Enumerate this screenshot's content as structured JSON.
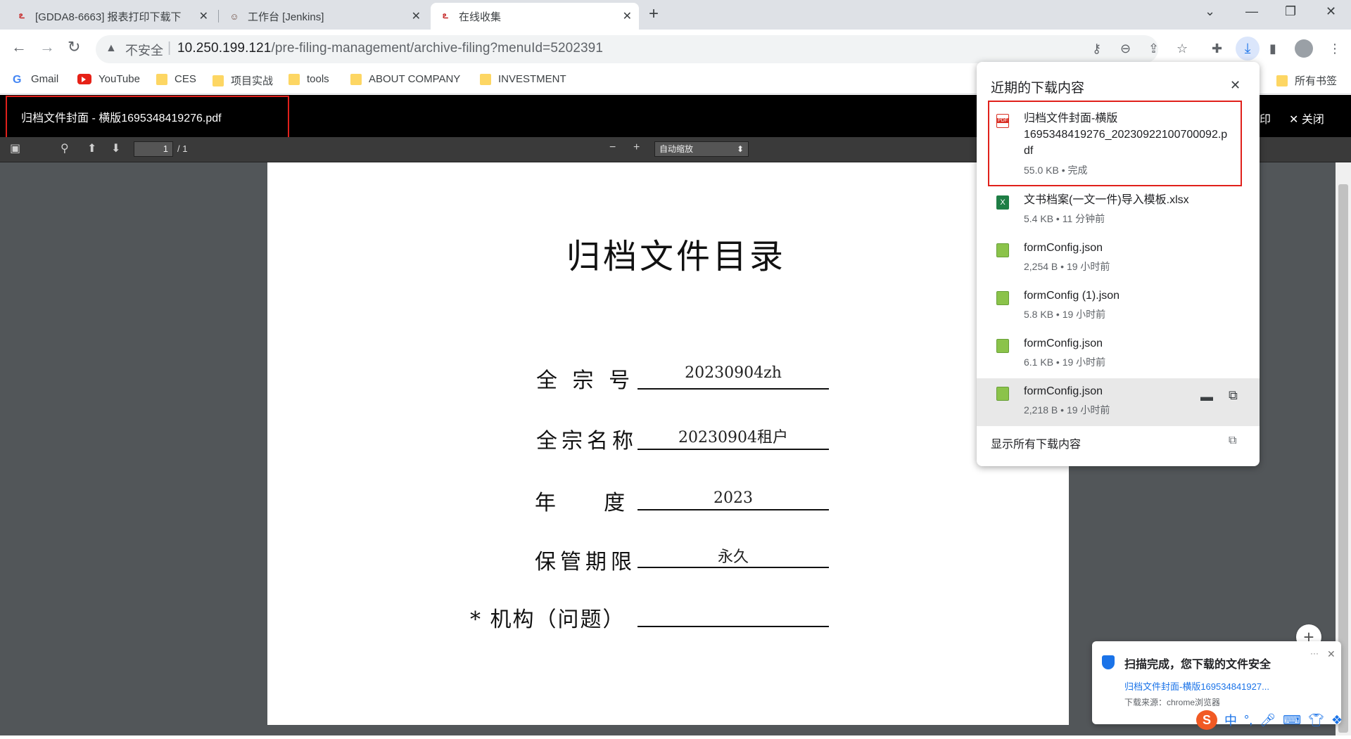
{
  "tabs": [
    {
      "title": "[GDDA8-6663] 报表打印下载下"
    },
    {
      "title": "工作台 [Jenkins]"
    },
    {
      "title": "在线收集"
    }
  ],
  "omnibox": {
    "security_label": "不安全",
    "url_host": "10.250.199.121",
    "url_path": "/pre-filing-management/archive-filing?menuId=5202391"
  },
  "bookmarks": [
    {
      "label": "Gmail",
      "icon": "google-icon"
    },
    {
      "label": "YouTube",
      "icon": "youtube-icon"
    },
    {
      "label": "CES",
      "icon": "folder-icon"
    },
    {
      "label": "项目实战",
      "icon": "folder-icon"
    },
    {
      "label": "tools",
      "icon": "folder-icon"
    },
    {
      "label": "ABOUT COMPANY",
      "icon": "folder-icon"
    },
    {
      "label": "INVESTMENT",
      "icon": "folder-icon"
    },
    {
      "label": "所有书签",
      "icon": "folder-icon"
    }
  ],
  "pdf": {
    "title": "归档文件封面 - 横版1695348419276.pdf",
    "print_label": "印",
    "close_label": "关闭",
    "page_current": "1",
    "page_total": "/ 1",
    "zoom": "自动缩放",
    "doc_title": "归档文件目录",
    "fields": [
      {
        "label": "全 宗 号",
        "value": "20230904zh"
      },
      {
        "label": "全宗名称",
        "value": "20230904租户"
      },
      {
        "label": "年    度",
        "value": "2023"
      },
      {
        "label": "保管期限",
        "value": "永久"
      },
      {
        "label": "* 机构（问题）",
        "value": ""
      }
    ]
  },
  "downloads": {
    "heading": "近期的下载内容",
    "items": [
      {
        "name": "归档文件封面-横版1695348419276_20230922100700092.pdf",
        "line1": "归档文件封面-横版",
        "line2": "1695348419276_20230922100700092.p",
        "line3": "df",
        "meta": "55.0 KB • 完成",
        "type": "pdf"
      },
      {
        "name": "文书档案(一文一件)导入模板.xlsx",
        "meta": "5.4 KB • 11 分钟前",
        "type": "xlsx"
      },
      {
        "name": "formConfig.json",
        "meta": "2,254 B • 19 小时前",
        "type": "json"
      },
      {
        "name": "formConfig (1).json",
        "meta": "5.8 KB • 19 小时前",
        "type": "json"
      },
      {
        "name": "formConfig.json",
        "meta": "6.1 KB • 19 小时前",
        "type": "json"
      },
      {
        "name": "formConfig.json",
        "meta": "2,218 B • 19 小时前",
        "type": "json"
      }
    ],
    "show_all": "显示所有下载内容"
  },
  "scan_popup": {
    "title": "扫描完成，您下载的文件安全",
    "file": "归档文件封面-横版169534841927...",
    "source": "下载来源：chrome浏览器"
  },
  "ime": {
    "mode": "中"
  },
  "colors": {
    "highlight_border": "#e0201b",
    "pdf_bg": "#525659",
    "accent": "#1a73e8"
  }
}
